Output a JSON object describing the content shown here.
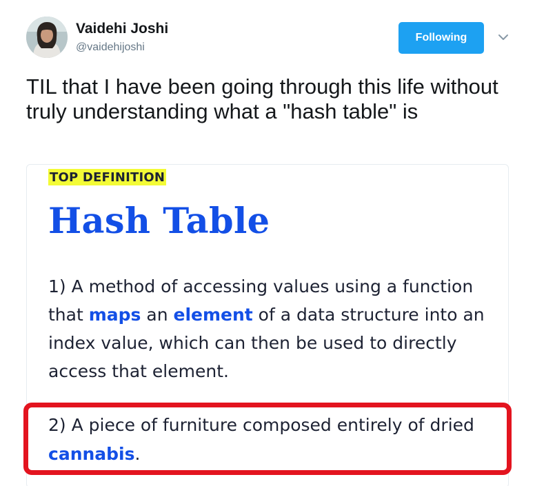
{
  "user": {
    "name": "Vaidehi Joshi",
    "handle": "@vaidehijoshi"
  },
  "follow_button": {
    "label": "Following",
    "color": "#1da1f2"
  },
  "menu_icon": "chevron-down-icon",
  "tweet": {
    "text": "TIL that I have been going through this life without truly understanding what a \"hash table\" is"
  },
  "card": {
    "badge": "TOP DEFINITION",
    "word": "Hash Table",
    "definition1": {
      "prefix": "1) A method of accessing values using a function that ",
      "link1": "maps",
      "middle1": " an ",
      "link2": "element",
      "suffix": " of a data structure into an index value, which can then be used to directly access that element."
    },
    "definition2": {
      "prefix": "2) A piece of furniture composed entirely of dried ",
      "link": "cannabis",
      "suffix": "."
    },
    "colors": {
      "link": "#134fe6",
      "badge_bg": "#f3fb36",
      "highlight_box": "#e3141f"
    }
  }
}
